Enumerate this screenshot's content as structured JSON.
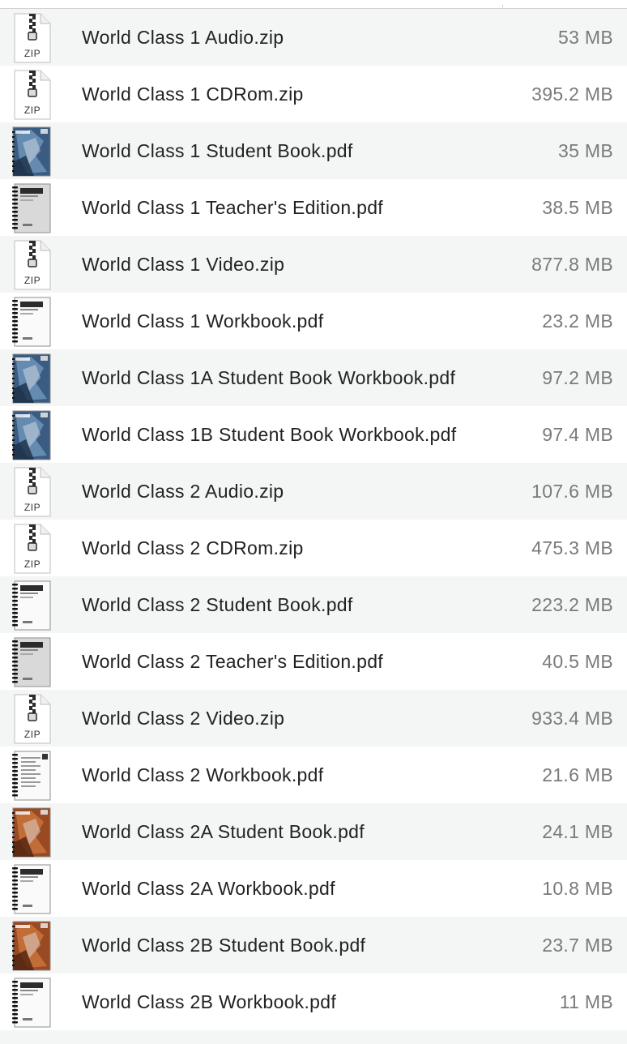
{
  "files": [
    {
      "name": "World Class 1 Audio.zip",
      "size": "53 MB",
      "icon": "zip-file-icon",
      "type": "zip"
    },
    {
      "name": "World Class 1 CDRom.zip",
      "size": "395.2 MB",
      "icon": "zip-file-icon",
      "type": "zip"
    },
    {
      "name": "World Class 1 Student Book.pdf",
      "size": "35 MB",
      "icon": "pdf-blue-cover-icon",
      "type": "cover-blue"
    },
    {
      "name": "World Class 1 Teacher's Edition.pdf",
      "size": "38.5 MB",
      "icon": "pdf-spiral-gray-icon",
      "type": "spiral-gray"
    },
    {
      "name": "World Class 1 Video.zip",
      "size": "877.8 MB",
      "icon": "zip-file-icon",
      "type": "zip"
    },
    {
      "name": "World Class 1 Workbook.pdf",
      "size": "23.2 MB",
      "icon": "pdf-spiral-white-icon",
      "type": "spiral-white"
    },
    {
      "name": "World Class 1A Student Book Workbook.pdf",
      "size": "97.2 MB",
      "icon": "pdf-blue-cover-icon",
      "type": "cover-blue"
    },
    {
      "name": "World Class 1B Student Book Workbook.pdf",
      "size": "97.4 MB",
      "icon": "pdf-blue-cover-icon",
      "type": "cover-blue"
    },
    {
      "name": "World Class 2 Audio.zip",
      "size": "107.6 MB",
      "icon": "zip-file-icon",
      "type": "zip"
    },
    {
      "name": "World Class 2 CDRom.zip",
      "size": "475.3 MB",
      "icon": "zip-file-icon",
      "type": "zip"
    },
    {
      "name": "World Class 2 Student Book.pdf",
      "size": "223.2 MB",
      "icon": "pdf-spiral-white-icon",
      "type": "spiral-white"
    },
    {
      "name": "World Class 2 Teacher's Edition.pdf",
      "size": "40.5 MB",
      "icon": "pdf-spiral-gray-icon",
      "type": "spiral-gray"
    },
    {
      "name": "World Class 2 Video.zip",
      "size": "933.4 MB",
      "icon": "zip-file-icon",
      "type": "zip"
    },
    {
      "name": "World Class 2 Workbook.pdf",
      "size": "21.6 MB",
      "icon": "pdf-spiral-doc-icon",
      "type": "spiral-doc"
    },
    {
      "name": "World Class 2A Student Book.pdf",
      "size": "24.1 MB",
      "icon": "pdf-orange-cover-icon",
      "type": "cover-orange"
    },
    {
      "name": "World Class 2A Workbook.pdf",
      "size": "10.8 MB",
      "icon": "pdf-spiral-white-icon",
      "type": "spiral-white"
    },
    {
      "name": "World Class 2B Student Book.pdf",
      "size": "23.7 MB",
      "icon": "pdf-orange-cover-icon",
      "type": "cover-orange"
    },
    {
      "name": "World Class 2B Workbook.pdf",
      "size": "11 MB",
      "icon": "pdf-spiral-white-icon",
      "type": "spiral-white"
    }
  ],
  "icon_labels": {
    "zip": "ZIP"
  },
  "colors": {
    "name_text": "#222222",
    "size_text": "#7a7a7a",
    "row_alt": "#f4f5f5"
  }
}
